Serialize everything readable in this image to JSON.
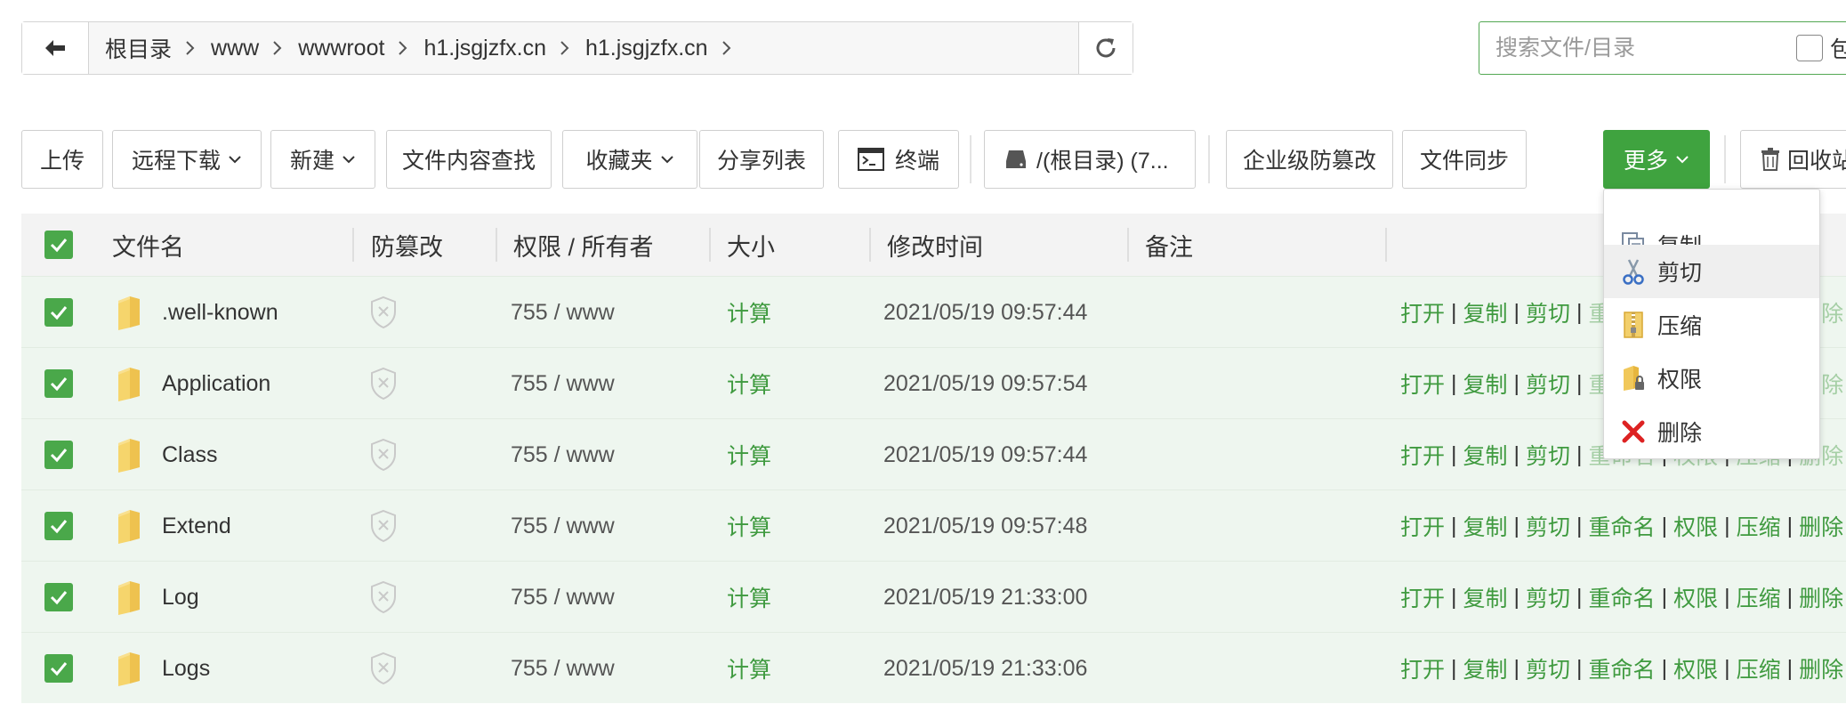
{
  "path": {
    "crumbs": [
      "根目录",
      "www",
      "wwwroot",
      "h1.jsgjzfx.cn",
      "h1.jsgjzfx.cn"
    ]
  },
  "search": {
    "placeholder": "搜索文件/目录",
    "checkbox_label": "包"
  },
  "toolbar": {
    "upload": "上传",
    "remote_download": "远程下载",
    "new": "新建",
    "content_search": "文件内容查找",
    "favorites": "收藏夹",
    "share_list": "分享列表",
    "terminal": "终端",
    "disk": "/(根目录) (7...",
    "tamper": "企业级防篡改",
    "sync": "文件同步",
    "more": "更多",
    "recycle": "回收站"
  },
  "table": {
    "headers": {
      "name": "文件名",
      "tamper": "防篡改",
      "perm": "权限 / 所有者",
      "size": "大小",
      "mtime": "修改时间",
      "note": "备注"
    },
    "rows": [
      {
        "name": ".well-known",
        "perm": "755 / www",
        "size": "计算",
        "mtime": "2021/05/19 09:57:44"
      },
      {
        "name": "Application",
        "perm": "755 / www",
        "size": "计算",
        "mtime": "2021/05/19 09:57:54"
      },
      {
        "name": "Class",
        "perm": "755 / www",
        "size": "计算",
        "mtime": "2021/05/19 09:57:44"
      },
      {
        "name": "Extend",
        "perm": "755 / www",
        "size": "计算",
        "mtime": "2021/05/19 09:57:48"
      },
      {
        "name": "Log",
        "perm": "755 / www",
        "size": "计算",
        "mtime": "2021/05/19 21:33:00"
      },
      {
        "name": "Logs",
        "perm": "755 / www",
        "size": "计算",
        "mtime": "2021/05/19 21:33:06"
      }
    ],
    "ops": {
      "open": "打开",
      "copy": "复制",
      "cut": "剪切",
      "rename": "重命名",
      "perm": "权限",
      "zip": "压缩",
      "del": "删除"
    }
  },
  "dropdown": {
    "items": [
      {
        "label": "复制",
        "icon": "copy-icon"
      },
      {
        "label": "剪切",
        "icon": "scissors-icon"
      },
      {
        "label": "压缩",
        "icon": "zip-icon"
      },
      {
        "label": "权限",
        "icon": "lock-folder-icon"
      },
      {
        "label": "删除",
        "icon": "delete-x-icon"
      }
    ]
  }
}
